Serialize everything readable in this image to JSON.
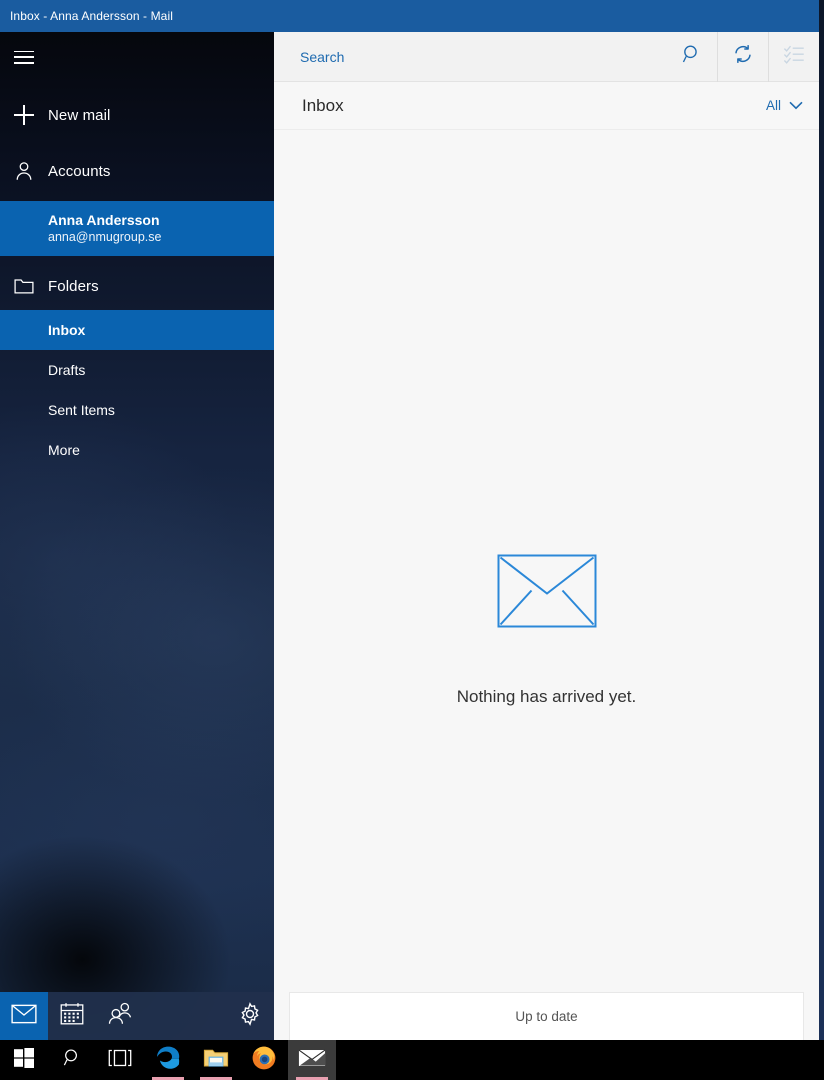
{
  "window": {
    "title": "Inbox - Anna Andersson - Mail"
  },
  "sidebar": {
    "menu_button": "hamburger-icon",
    "new_mail_label": "New mail",
    "accounts_label": "Accounts",
    "account": {
      "name": "Anna Andersson",
      "email": "anna@nmugroup.se"
    },
    "folders_label": "Folders",
    "folders": [
      {
        "label": "Inbox",
        "selected": true
      },
      {
        "label": "Drafts",
        "selected": false
      },
      {
        "label": "Sent Items",
        "selected": false
      },
      {
        "label": "More",
        "selected": false
      }
    ],
    "appbar": [
      {
        "name": "mail",
        "icon": "envelope-icon",
        "active": true
      },
      {
        "name": "calendar",
        "icon": "calendar-icon",
        "active": false
      },
      {
        "name": "people",
        "icon": "people-icon",
        "active": false
      },
      {
        "name": "settings",
        "icon": "gear-icon",
        "active": false
      }
    ]
  },
  "search": {
    "placeholder": "Search",
    "search_icon": "magnifier-icon",
    "sync_icon": "sync-icon",
    "select_icon": "selection-mode-icon"
  },
  "list_header": {
    "title": "Inbox",
    "filter_label": "All",
    "filter_icon": "chevron-down-icon"
  },
  "empty_state": {
    "icon": "envelope-outline-icon",
    "caption": "Nothing has arrived yet."
  },
  "status": {
    "text": "Up to date"
  },
  "taskbar": {
    "items": [
      {
        "name": "start",
        "icon": "windows-logo-icon"
      },
      {
        "name": "search",
        "icon": "magnifier-icon"
      },
      {
        "name": "task-view",
        "icon": "task-view-icon"
      },
      {
        "name": "edge",
        "icon": "edge-icon"
      },
      {
        "name": "file-explorer",
        "icon": "folder-icon"
      },
      {
        "name": "firefox",
        "icon": "firefox-icon"
      },
      {
        "name": "mail",
        "icon": "mail-envelope-icon"
      }
    ]
  },
  "colors": {
    "accent": "#0a63b0",
    "titlebar": "#1a5ca0",
    "link_blue": "#1f6bb0",
    "pane_bg": "#f7f7f7"
  }
}
